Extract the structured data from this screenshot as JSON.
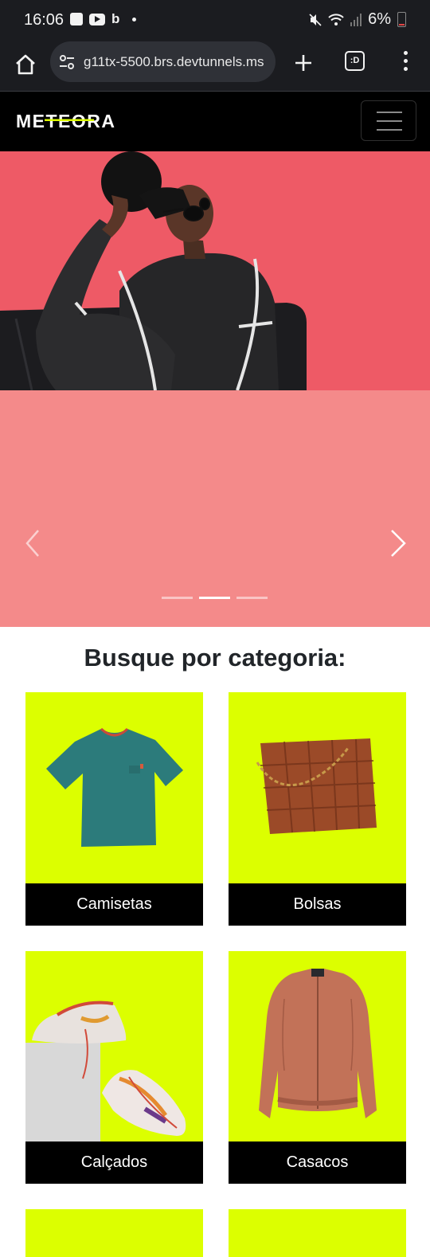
{
  "status_bar": {
    "time": "16:06",
    "battery": "6%"
  },
  "browser": {
    "url": "g11tx-5500.brs.devtunnels.ms",
    "tabs_label": ":D"
  },
  "site": {
    "logo_text": "METEORA"
  },
  "hero": {
    "slides_count": 3,
    "active_slide": 2
  },
  "categories": {
    "title": "Busque por categoria:",
    "items": [
      {
        "label": "Camisetas",
        "icon": "tshirt"
      },
      {
        "label": "Bolsas",
        "icon": "handbag"
      },
      {
        "label": "Calçados",
        "icon": "sneakers"
      },
      {
        "label": "Casacos",
        "icon": "jacket"
      }
    ]
  },
  "colors": {
    "accent": "#dcff00",
    "hero_bg": "#f48a8a",
    "navbar": "#000000",
    "caption_bg": "#000000"
  }
}
